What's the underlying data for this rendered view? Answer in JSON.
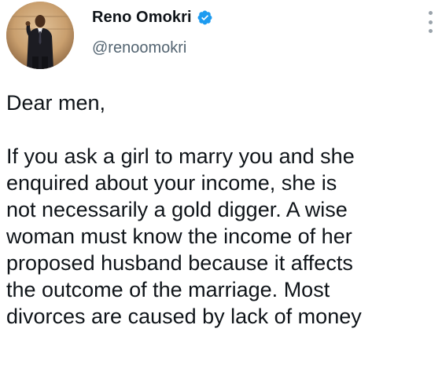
{
  "tweet": {
    "author": {
      "display_name": "Reno Omokri",
      "handle": "@renoomokri",
      "verified": true,
      "avatar_icon": "person-speaking-avatar"
    },
    "more_icon": "vertical-ellipsis-icon",
    "greeting": "Dear men,",
    "body_lines": [
      "If you ask a girl to marry you and she",
      "enquired about your income, she is",
      "not necessarily a gold digger. A wise",
      "woman must know the income of her",
      "proposed husband because it affects",
      "the outcome of the marriage. Most",
      "divorces are caused by lack of money"
    ]
  },
  "colors": {
    "text": "#0f1419",
    "secondary_text": "#536471",
    "verified_badge": "#1d9bf0"
  }
}
